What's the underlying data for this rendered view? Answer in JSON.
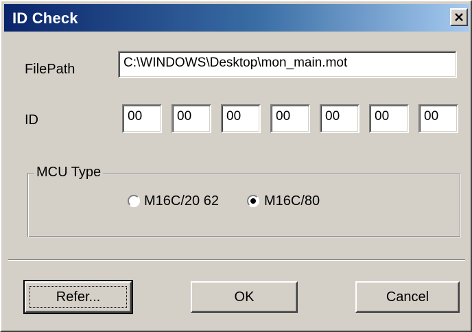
{
  "dialog": {
    "title": "ID Check",
    "close_icon": "close-icon"
  },
  "filepath": {
    "label": "FilePath",
    "value": "C:\\WINDOWS\\Desktop\\mon_main.mot"
  },
  "id": {
    "label": "ID",
    "fields": [
      "00",
      "00",
      "00",
      "00",
      "00",
      "00",
      "00"
    ]
  },
  "mcu_type": {
    "legend": "MCU Type",
    "options": [
      {
        "label": "M16C/20 62",
        "selected": false
      },
      {
        "label": "M16C/80",
        "selected": true
      }
    ]
  },
  "buttons": {
    "refer": "Refer...",
    "ok": "OK",
    "cancel": "Cancel"
  },
  "colors": {
    "title_start": "#0a246a",
    "title_end": "#a6caf0",
    "face": "#d4d0c8"
  }
}
